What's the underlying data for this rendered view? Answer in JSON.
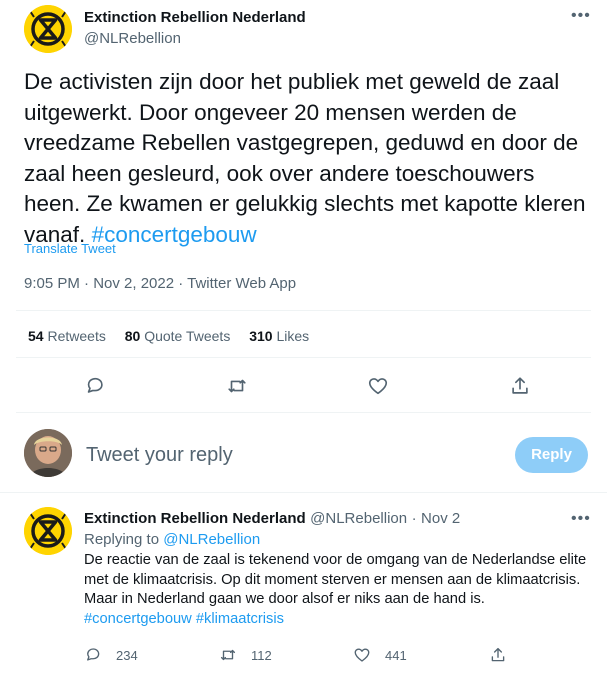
{
  "main_tweet": {
    "author_name": "Extinction Rebellion Nederland",
    "author_handle": "@NLRebellion",
    "more_label": "•••",
    "text": "De activisten zijn door het publiek met geweld de zaal uitgewerkt. Door ongeveer 20 mensen werden de vreedzame Rebellen vastgegrepen, geduwd en door de zaal heen gesleurd, ook over andere toeschouwers heen. Ze kwamen er gelukkig slechts met kapotte kleren vanaf.",
    "hashtag": "#concertgebouw",
    "translate_label": "Translate Tweet",
    "meta": "9:05 PM · Nov 2, 2022 · Twitter Web App",
    "stats": [
      {
        "count": "54",
        "label": "Retweets"
      },
      {
        "count": "80",
        "label": "Quote Tweets"
      },
      {
        "count": "310",
        "label": "Likes"
      }
    ]
  },
  "reply_box": {
    "placeholder": "Tweet your reply",
    "button_label": "Reply"
  },
  "reply_tweet": {
    "author_name": "Extinction Rebellion Nederland",
    "author_handle": "@NLRebellion",
    "separator": "·",
    "date": "Nov 2",
    "more_label": "•••",
    "replying_prefix": "Replying to",
    "replying_handle": "@NLRebellion",
    "text": "De reactie van de zaal is tekenend voor de omgang van de Nederlandse elite met de klimaatcrisis. Op dit moment sterven er mensen aan de klimaatcrisis. Maar in Nederland gaan we door alsof er niks aan de hand is.",
    "hashtags": "#concertgebouw #klimaatcrisis",
    "reply_count": "234",
    "retweet_count": "112",
    "like_count": "441"
  },
  "colors": {
    "accent": "#1d9bf0",
    "muted": "#536471",
    "reply_button": "#8ecdf8",
    "xr_yellow": "#ffd400"
  }
}
